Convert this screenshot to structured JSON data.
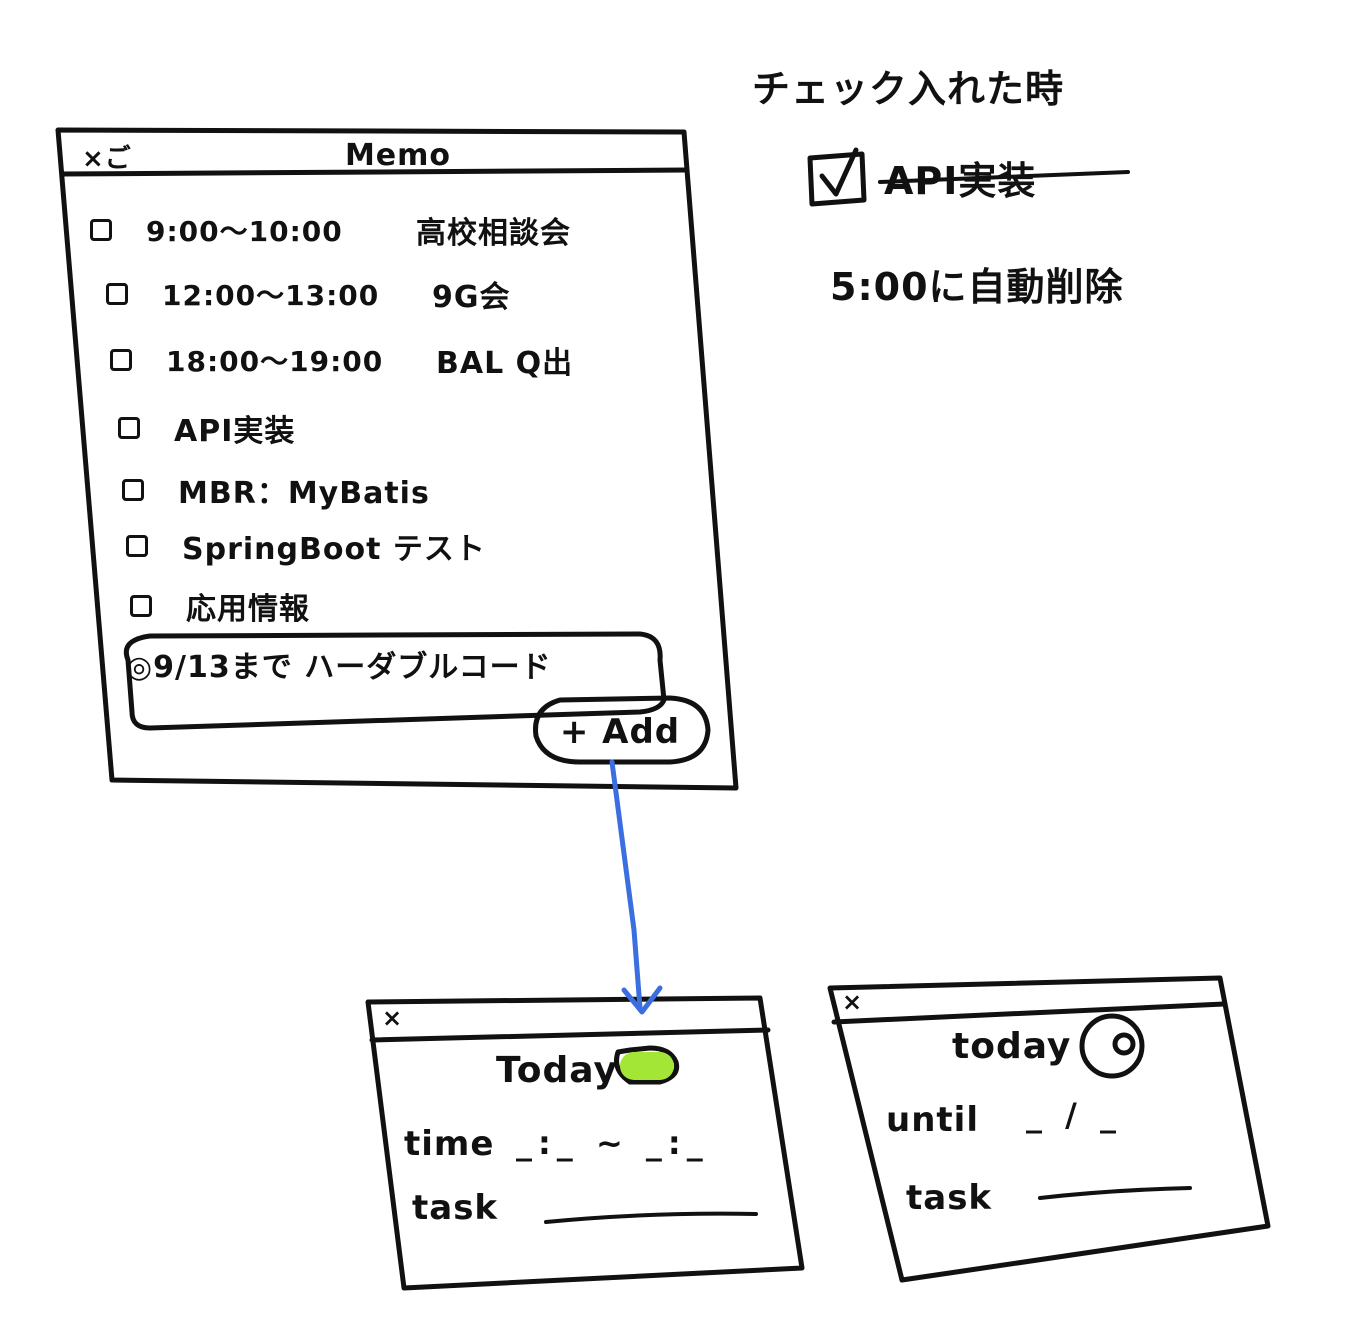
{
  "memo": {
    "close_label": "×ご",
    "title": "Memo",
    "items": [
      {
        "time": "9:00〜10:00",
        "task": "高校相談会"
      },
      {
        "time": "12:00〜13:00",
        "task": "9G会"
      },
      {
        "time": "18:00〜19:00",
        "task": "BAL Q出"
      },
      {
        "task": "API実装"
      },
      {
        "task": "MBR：MyBatis"
      },
      {
        "task": "SpringBoot テスト"
      },
      {
        "task": "応用情報"
      }
    ],
    "deadline_item": "◎9/13まで ハーダブルコード",
    "add_button": "+ Add"
  },
  "today_time_window": {
    "close_label": "×",
    "title": "Today",
    "time_label": "time",
    "time_placeholder": "_:_ ~ _:_",
    "task_label": "task",
    "toggle_color": "#a3e635"
  },
  "today_until_window": {
    "close_label": "×",
    "title": "today",
    "until_label": "until",
    "until_placeholder": "_ / _",
    "task_label": "task"
  },
  "notes": {
    "heading": "チェック入れた時",
    "checked_example": "API実装",
    "auto_delete": "5:00に自動削除"
  },
  "arrow_color": "#3b6fe0"
}
